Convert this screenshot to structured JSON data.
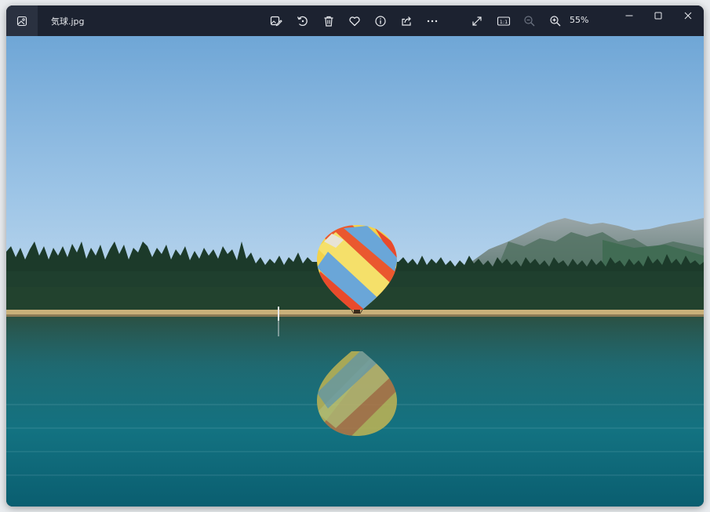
{
  "window": {
    "file_name": "気球.jpg",
    "zoom_level": "55%"
  },
  "toolbar": {
    "icons": [
      "edit-image-icon",
      "rotate-icon",
      "delete-icon",
      "favorite-icon",
      "info-icon",
      "share-icon",
      "more-icon",
      "fullscreen-icon",
      "actual-size-icon",
      "zoom-out-icon",
      "zoom-in-icon"
    ],
    "actual_size_label": "1:1"
  },
  "window_controls": [
    "minimize-icon",
    "maximize-icon",
    "close-icon"
  ],
  "colors": {
    "titlebar": "#1c2230",
    "icon": "#e8eaee",
    "icon_disabled": "#6b7280"
  }
}
